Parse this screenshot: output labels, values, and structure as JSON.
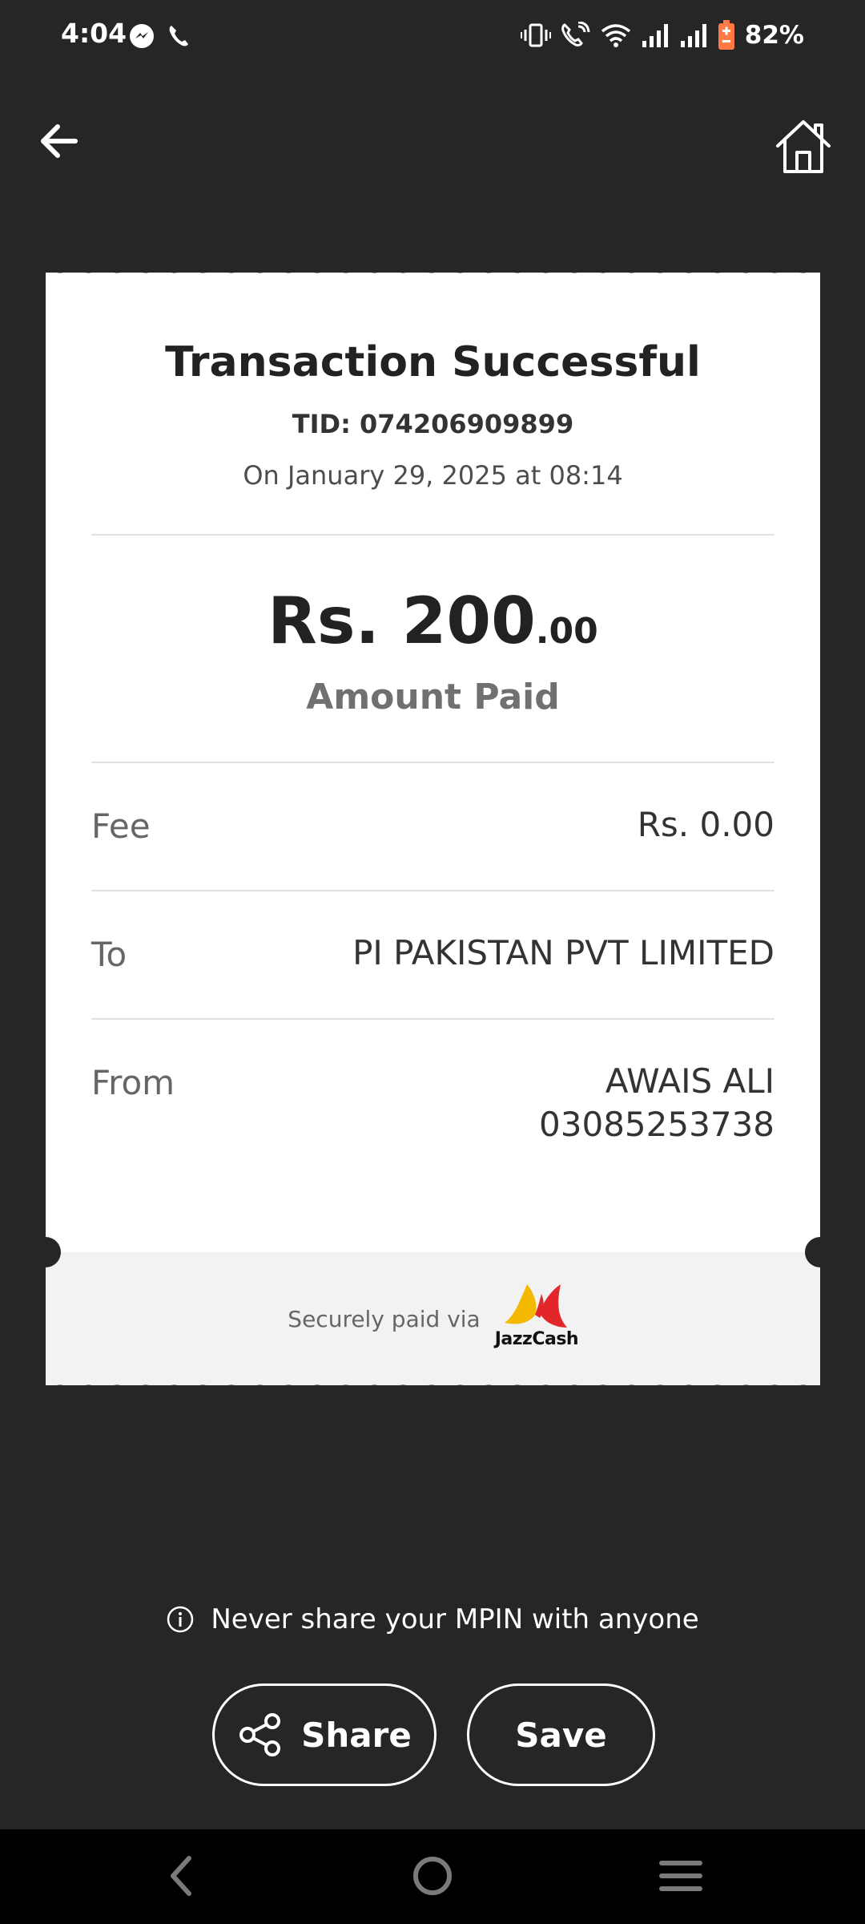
{
  "status_bar": {
    "time": "4:04",
    "battery_percent": "82%",
    "left_icons": [
      "messenger-icon",
      "phone-call-icon"
    ],
    "right_icons": [
      "vibrate-icon",
      "wifi-calling-icon",
      "wifi-icon",
      "signal-icon",
      "signal-icon",
      "battery-icon"
    ]
  },
  "header": {
    "back_icon": "arrow-left-icon",
    "home_icon": "home-icon"
  },
  "receipt": {
    "title": "Transaction Successful",
    "tid": "TID: 074206909899",
    "date": "On January 29, 2025 at 08:14",
    "amount_main": "Rs. 200",
    "amount_cents": ".00",
    "amount_label": "Amount Paid",
    "fee_label": "Fee",
    "fee_value": "Rs. 0.00",
    "to_label": "To",
    "to_value": "PI PAKISTAN PVT LIMITED",
    "from_label": "From",
    "from_name": "AWAIS ALI",
    "from_number": "03085253738",
    "footer_text": "Securely paid via",
    "logo_text": "JazzCash"
  },
  "notice": {
    "text": "Never share your MPIN with anyone",
    "icon": "info-icon"
  },
  "actions": {
    "share_label": "Share",
    "save_label": "Save"
  },
  "colors": {
    "background": "#262626",
    "card": "#ffffff",
    "card_footer": "#f2f2f2",
    "logo_yellow": "#f5b800",
    "logo_red": "#e3262a",
    "battery_orange": "#ff7a45"
  }
}
